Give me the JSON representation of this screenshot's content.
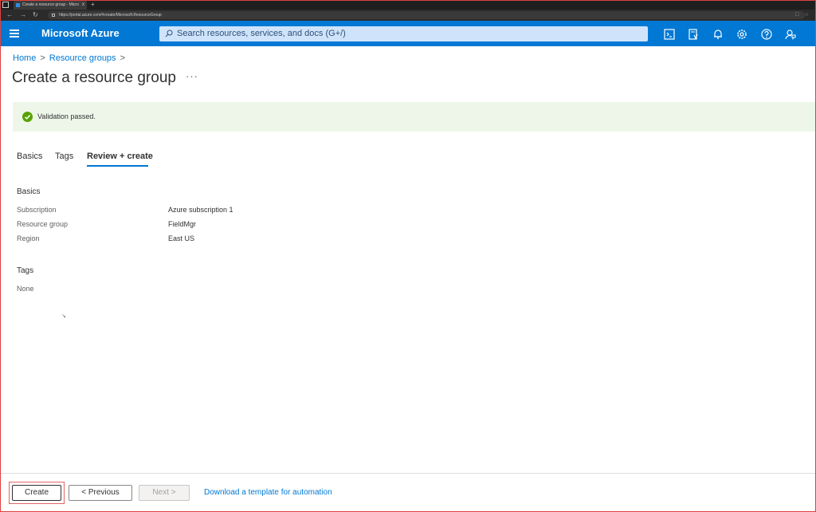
{
  "browser": {
    "tab_title": "Create a resource group - Micro",
    "tab_close": "x",
    "new_tab": "+",
    "url": "https://portal.azure.com/#create/Microsoft.ResourceGroup"
  },
  "topbar": {
    "brand": "Microsoft Azure",
    "search_placeholder": "Search resources, services, and docs (G+/)",
    "icons": [
      "cloud-shell-icon",
      "directory-filter-icon",
      "notifications-icon",
      "settings-icon",
      "help-icon",
      "feedback-icon"
    ],
    "accent_color": "#0078d4"
  },
  "breadcrumb": {
    "items": [
      "Home",
      "Resource groups"
    ],
    "separator": ">"
  },
  "page": {
    "title": "Create a resource group",
    "more_label": "···"
  },
  "validation": {
    "message": "Validation passed.",
    "status_color": "#57a300"
  },
  "tabs": [
    {
      "label": "Basics",
      "active": false
    },
    {
      "label": "Tags",
      "active": false
    },
    {
      "label": "Review + create",
      "active": true
    }
  ],
  "review": {
    "basics": {
      "heading": "Basics",
      "rows": [
        {
          "label": "Subscription",
          "value": "Azure subscription 1"
        },
        {
          "label": "Resource group",
          "value": "FieldMgr"
        },
        {
          "label": "Region",
          "value": "East US"
        }
      ]
    },
    "tags": {
      "heading": "Tags",
      "value": "None"
    }
  },
  "footer": {
    "create": "Create",
    "previous": "< Previous",
    "next": "Next >",
    "download_link": "Download a template for automation"
  }
}
